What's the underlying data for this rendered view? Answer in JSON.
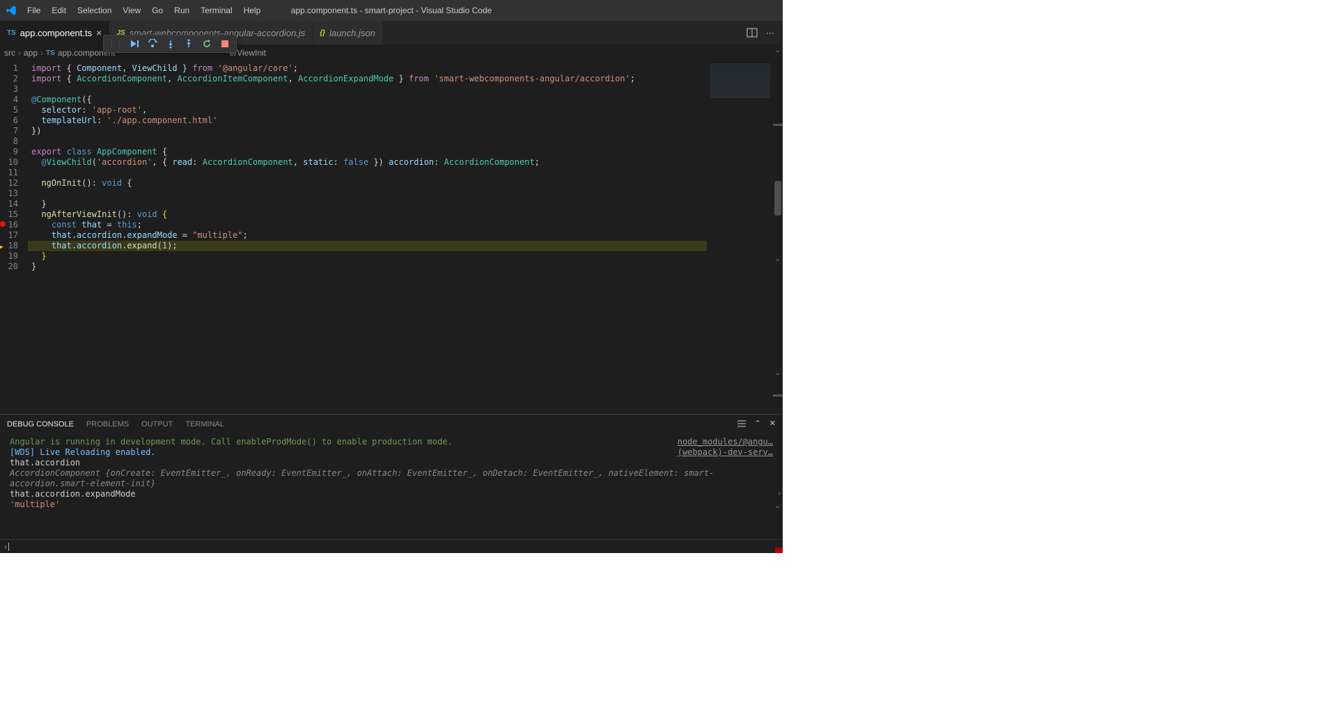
{
  "titlebar": {
    "title": "app.component.ts - smart-project - Visual Studio Code",
    "menus": [
      "File",
      "Edit",
      "Selection",
      "View",
      "Go",
      "Run",
      "Terminal",
      "Help"
    ]
  },
  "tabs": [
    {
      "icon": "TS",
      "label": "app.component.ts",
      "active": true,
      "close": true
    },
    {
      "icon": "JS",
      "label": "smart-webcomponents-angular-accordion.js",
      "active": false,
      "italic": true
    },
    {
      "icon": "{}",
      "label": "launch.json",
      "active": false,
      "italic": true
    }
  ],
  "breadcrumb": {
    "parts": [
      "src",
      "app",
      "app.component"
    ],
    "tail": "erViewInit"
  },
  "debug_toolbar": [
    "continue",
    "step-over",
    "step-into",
    "step-out",
    "restart",
    "stop"
  ],
  "chart_data": null,
  "editor": {
    "current_line": 18,
    "breakpoint_line": 16,
    "lines": [
      {
        "n": 1,
        "html": "<span class='kw'>import</span> <span class='pun'>{</span> <span class='prop'>Component, ViewChild }</span> <span class='kw'>from</span> <span class='str'>'@angular/core'</span><span class='pun'>;</span>"
      },
      {
        "n": 2,
        "html": "<span class='kw'>import</span> <span class='pun'>{</span> <span class='type'>AccordionComponent</span><span class='pun'>,</span> <span class='type'>AccordionItemComponent</span><span class='pun'>,</span> <span class='type'>AccordionExpandMode</span> <span class='pun'>}</span> <span class='kw'>from</span> <span class='str'>'smart-webcomponents-angular/accordion'</span><span class='pun'>;</span>"
      },
      {
        "n": 3,
        "html": ""
      },
      {
        "n": 4,
        "html": "<span class='at'>@</span><span class='dec'>Component</span><span class='pun'>({</span>"
      },
      {
        "n": 5,
        "html": "  <span class='prop'>selector</span><span class='pun'>:</span> <span class='str'>'app-root'</span><span class='pun'>,</span>"
      },
      {
        "n": 6,
        "html": "  <span class='prop'>templateUrl</span><span class='pun'>:</span> <span class='str'>'./app.component.html'</span>"
      },
      {
        "n": 7,
        "html": "<span class='pun'>})</span>"
      },
      {
        "n": 8,
        "html": ""
      },
      {
        "n": 9,
        "html": "<span class='kw'>export</span> <span class='kw2'>class</span> <span class='type'>AppComponent</span> <span class='pun'>{</span>"
      },
      {
        "n": 10,
        "html": "  <span class='at'>@</span><span class='dec'>ViewChild</span><span class='pun'>(</span><span class='str'>'accordion'</span><span class='pun'>, {</span> <span class='prop'>read</span><span class='pun'>:</span> <span class='type'>AccordionComponent</span><span class='pun'>,</span> <span class='prop'>static</span><span class='pun'>:</span> <span class='kw2'>false</span> <span class='pun'>})</span> <span class='prop'>accordion</span><span class='pun'>:</span> <span class='type'>AccordionComponent</span><span class='pun'>;</span>"
      },
      {
        "n": 11,
        "html": ""
      },
      {
        "n": 12,
        "html": "  <span class='fn'>ngOnInit</span><span class='pun'>():</span> <span class='kw2'>void</span> <span class='pun'>{</span>"
      },
      {
        "n": 13,
        "html": ""
      },
      {
        "n": 14,
        "html": "  <span class='pun'>}</span>"
      },
      {
        "n": 15,
        "html": "  <span class='fn'>ngAfterViewInit</span><span class='pun'>():</span> <span class='kw2'>void</span> <span class='brk'>{</span>"
      },
      {
        "n": 16,
        "html": "    <span class='kw2'>const</span> <span class='prop'>that</span> <span class='pun'>=</span> <span class='kw2'>this</span><span class='pun'>;</span>"
      },
      {
        "n": 17,
        "html": "    <span class='prop'>that</span><span class='pun'>.</span><span class='prop'>accordion</span><span class='pun'>.</span><span class='prop'>expandMode</span> <span class='pun'>=</span> <span class='str'>\"multiple\"</span><span class='pun'>;</span>"
      },
      {
        "n": 18,
        "html": "    <span class='prop'>that</span><span class='pun'>.</span><span class='prop'>accordion</span><span class='pun'>.</span><span class='fn'>expand</span><span class='pun'>(</span><span class='num'>1</span><span class='pun'>);</span>",
        "hl": true
      },
      {
        "n": 19,
        "html": "  <span class='brk'>}</span>"
      },
      {
        "n": 20,
        "html": "<span class='pun'>}</span>"
      }
    ]
  },
  "panel": {
    "tabs": [
      "DEBUG CONSOLE",
      "PROBLEMS",
      "OUTPUT",
      "TERMINAL"
    ],
    "active": "DEBUG CONSOLE",
    "links": [
      "node_modules/@angu…",
      "(webpack)-dev-serv…"
    ],
    "lines": [
      {
        "html": "<span class='cinfo'>Angular is running in development mode. Call enableProdMode() to enable production mode.</span>"
      },
      {
        "html": "<span class='cblue'>[WDS] Live Reloading enabled.</span>"
      },
      {
        "html": "<span class='cobj'>that.accordion</span>"
      },
      {
        "html": "<span class='chv'>›</span><span class='cit'>AccordionComponent {onCreate: EventEmitter_, onReady: EventEmitter_, onAttach: EventEmitter_, onDetach: EventEmitter_, nativeElement: smart-accordion.smart-element-init}</span>"
      },
      {
        "html": "<span class='cobj'>that.accordion.expandMode</span>"
      },
      {
        "html": "<span class='cstr'>'multiple'</span>"
      }
    ]
  }
}
